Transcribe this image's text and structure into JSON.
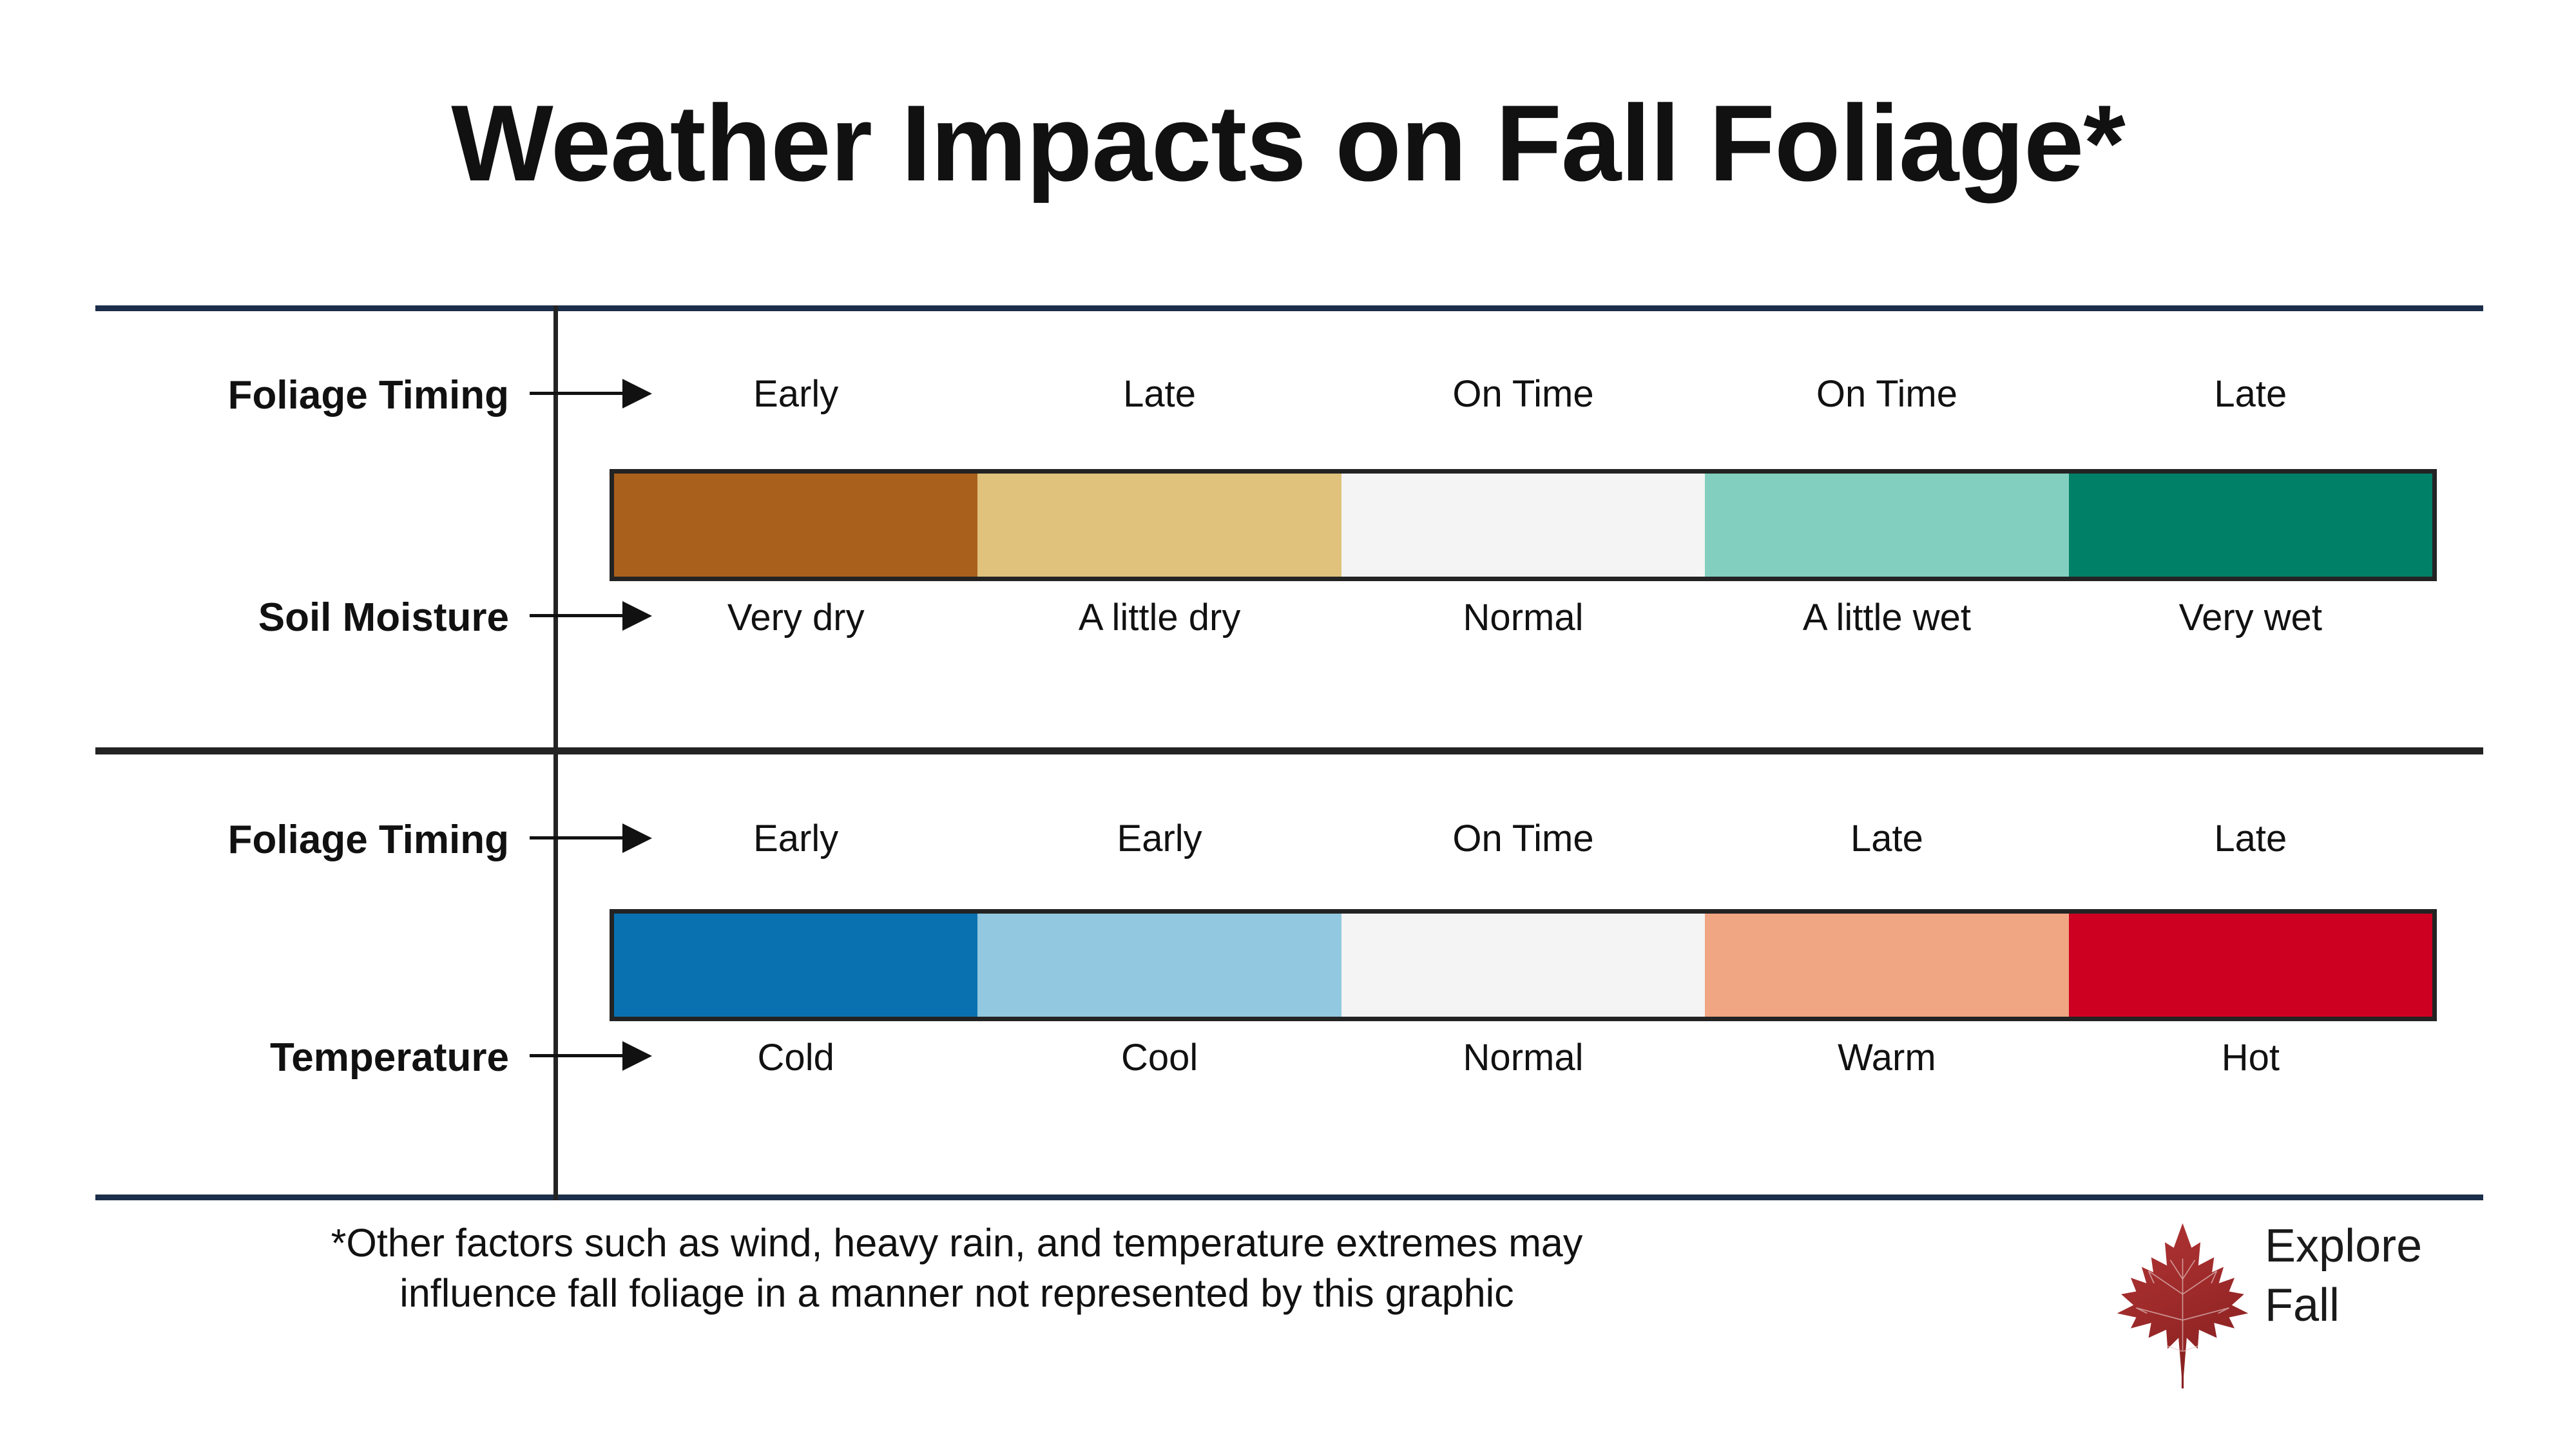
{
  "title": "Weather Impacts on Fall Foliage*",
  "footnote": {
    "line1": "*Other factors such as wind, heavy rain, and temperature extremes may",
    "line2": "influence fall foliage in a manner not represented by this graphic"
  },
  "logo": {
    "line1": "Explore",
    "line2": "Fall",
    "leaf_color": "#a32a2a"
  },
  "colors": {
    "rule_navy": "#1c2e4a",
    "rule_dark": "#232323",
    "bar_border": "#232323"
  },
  "blocks": [
    {
      "id": "soil-moisture",
      "top_label": "Foliage Timing",
      "bottom_label": "Soil Moisture",
      "top_values": [
        "Early",
        "Late",
        "On Time",
        "On Time",
        "Late"
      ],
      "bottom_values": [
        "Very dry",
        "A little dry",
        "Normal",
        "A little wet",
        "Very wet"
      ],
      "segment_colors": [
        "#a9601c",
        "#e0c27d",
        "#f4f4f4",
        "#82cfc0",
        "#008066"
      ]
    },
    {
      "id": "temperature",
      "top_label": "Foliage Timing",
      "bottom_label": "Temperature",
      "top_values": [
        "Early",
        "Early",
        "On Time",
        "Late",
        "Late"
      ],
      "bottom_values": [
        "Cold",
        "Cool",
        "Normal",
        "Warm",
        "Hot"
      ],
      "segment_colors": [
        "#0a71b0",
        "#92c8e0",
        "#f4f4f4",
        "#f0a583",
        "#ce0022"
      ]
    }
  ],
  "chart_data": {
    "type": "table",
    "title": "Weather Impacts on Fall Foliage*",
    "note": "*Other factors such as wind, heavy rain, and temperature extremes may influence fall foliage in a manner not represented by this graphic",
    "panels": [
      {
        "driver": "Soil Moisture",
        "response": "Foliage Timing",
        "categories": [
          "Very dry",
          "A little dry",
          "Normal",
          "A little wet",
          "Very wet"
        ],
        "values": [
          "Early",
          "Late",
          "On Time",
          "On Time",
          "Late"
        ],
        "colors": [
          "#a9601c",
          "#e0c27d",
          "#f4f4f4",
          "#82cfc0",
          "#008066"
        ]
      },
      {
        "driver": "Temperature",
        "response": "Foliage Timing",
        "categories": [
          "Cold",
          "Cool",
          "Normal",
          "Warm",
          "Hot"
        ],
        "values": [
          "Early",
          "Early",
          "On Time",
          "Late",
          "Late"
        ],
        "colors": [
          "#0a71b0",
          "#92c8e0",
          "#f4f4f4",
          "#f0a583",
          "#ce0022"
        ]
      }
    ]
  }
}
